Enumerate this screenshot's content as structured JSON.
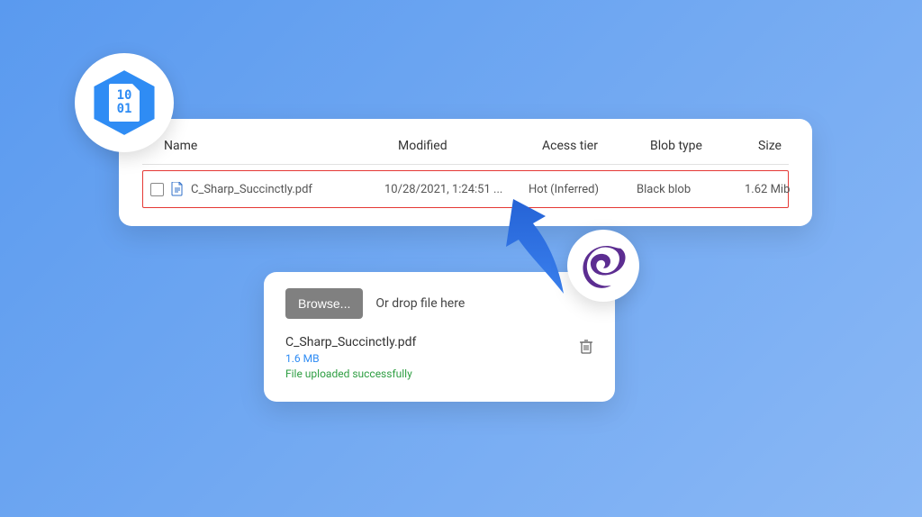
{
  "logo": {
    "bits_top": "10",
    "bits_bottom": "01"
  },
  "table": {
    "headers": {
      "name": "Name",
      "modified": "Modified",
      "access_tier": "Acess tier",
      "blob_type": "Blob type",
      "size": "Size"
    },
    "row": {
      "name": "C_Sharp_Succinctly.pdf",
      "modified": "10/28/2021, 1:24:51 ...",
      "access_tier": "Hot (Inferred)",
      "blob_type": "Black blob",
      "size": "1.62 Mib"
    }
  },
  "upload": {
    "browse_label": "Browse...",
    "drop_label": "Or drop file here",
    "file_name": "C_Sharp_Succinctly.pdf",
    "file_size": "1.6 MB",
    "status": "File uploaded successfully"
  }
}
